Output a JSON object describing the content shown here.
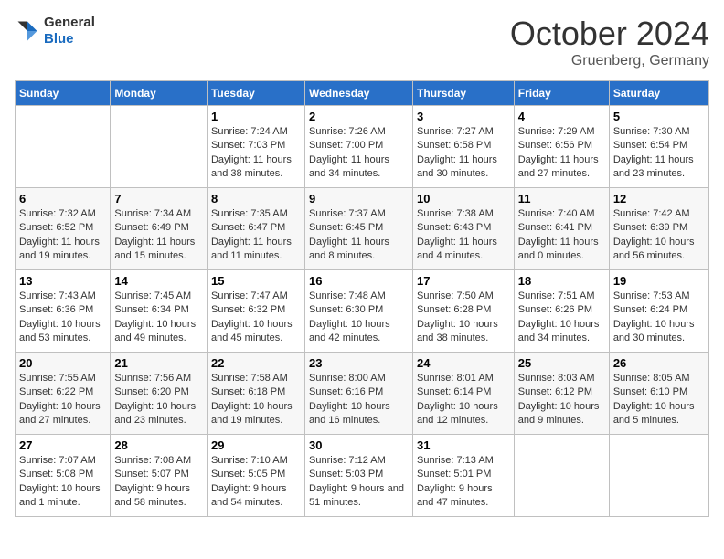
{
  "header": {
    "logo": {
      "general": "General",
      "blue": "Blue"
    },
    "title": "October 2024",
    "location": "Gruenberg, Germany"
  },
  "weekdays": [
    "Sunday",
    "Monday",
    "Tuesday",
    "Wednesday",
    "Thursday",
    "Friday",
    "Saturday"
  ],
  "weeks": [
    [
      {
        "day": "",
        "info": ""
      },
      {
        "day": "",
        "info": ""
      },
      {
        "day": "1",
        "info": "Sunrise: 7:24 AM\nSunset: 7:03 PM\nDaylight: 11 hours and 38 minutes."
      },
      {
        "day": "2",
        "info": "Sunrise: 7:26 AM\nSunset: 7:00 PM\nDaylight: 11 hours and 34 minutes."
      },
      {
        "day": "3",
        "info": "Sunrise: 7:27 AM\nSunset: 6:58 PM\nDaylight: 11 hours and 30 minutes."
      },
      {
        "day": "4",
        "info": "Sunrise: 7:29 AM\nSunset: 6:56 PM\nDaylight: 11 hours and 27 minutes."
      },
      {
        "day": "5",
        "info": "Sunrise: 7:30 AM\nSunset: 6:54 PM\nDaylight: 11 hours and 23 minutes."
      }
    ],
    [
      {
        "day": "6",
        "info": "Sunrise: 7:32 AM\nSunset: 6:52 PM\nDaylight: 11 hours and 19 minutes."
      },
      {
        "day": "7",
        "info": "Sunrise: 7:34 AM\nSunset: 6:49 PM\nDaylight: 11 hours and 15 minutes."
      },
      {
        "day": "8",
        "info": "Sunrise: 7:35 AM\nSunset: 6:47 PM\nDaylight: 11 hours and 11 minutes."
      },
      {
        "day": "9",
        "info": "Sunrise: 7:37 AM\nSunset: 6:45 PM\nDaylight: 11 hours and 8 minutes."
      },
      {
        "day": "10",
        "info": "Sunrise: 7:38 AM\nSunset: 6:43 PM\nDaylight: 11 hours and 4 minutes."
      },
      {
        "day": "11",
        "info": "Sunrise: 7:40 AM\nSunset: 6:41 PM\nDaylight: 11 hours and 0 minutes."
      },
      {
        "day": "12",
        "info": "Sunrise: 7:42 AM\nSunset: 6:39 PM\nDaylight: 10 hours and 56 minutes."
      }
    ],
    [
      {
        "day": "13",
        "info": "Sunrise: 7:43 AM\nSunset: 6:36 PM\nDaylight: 10 hours and 53 minutes."
      },
      {
        "day": "14",
        "info": "Sunrise: 7:45 AM\nSunset: 6:34 PM\nDaylight: 10 hours and 49 minutes."
      },
      {
        "day": "15",
        "info": "Sunrise: 7:47 AM\nSunset: 6:32 PM\nDaylight: 10 hours and 45 minutes."
      },
      {
        "day": "16",
        "info": "Sunrise: 7:48 AM\nSunset: 6:30 PM\nDaylight: 10 hours and 42 minutes."
      },
      {
        "day": "17",
        "info": "Sunrise: 7:50 AM\nSunset: 6:28 PM\nDaylight: 10 hours and 38 minutes."
      },
      {
        "day": "18",
        "info": "Sunrise: 7:51 AM\nSunset: 6:26 PM\nDaylight: 10 hours and 34 minutes."
      },
      {
        "day": "19",
        "info": "Sunrise: 7:53 AM\nSunset: 6:24 PM\nDaylight: 10 hours and 30 minutes."
      }
    ],
    [
      {
        "day": "20",
        "info": "Sunrise: 7:55 AM\nSunset: 6:22 PM\nDaylight: 10 hours and 27 minutes."
      },
      {
        "day": "21",
        "info": "Sunrise: 7:56 AM\nSunset: 6:20 PM\nDaylight: 10 hours and 23 minutes."
      },
      {
        "day": "22",
        "info": "Sunrise: 7:58 AM\nSunset: 6:18 PM\nDaylight: 10 hours and 19 minutes."
      },
      {
        "day": "23",
        "info": "Sunrise: 8:00 AM\nSunset: 6:16 PM\nDaylight: 10 hours and 16 minutes."
      },
      {
        "day": "24",
        "info": "Sunrise: 8:01 AM\nSunset: 6:14 PM\nDaylight: 10 hours and 12 minutes."
      },
      {
        "day": "25",
        "info": "Sunrise: 8:03 AM\nSunset: 6:12 PM\nDaylight: 10 hours and 9 minutes."
      },
      {
        "day": "26",
        "info": "Sunrise: 8:05 AM\nSunset: 6:10 PM\nDaylight: 10 hours and 5 minutes."
      }
    ],
    [
      {
        "day": "27",
        "info": "Sunrise: 7:07 AM\nSunset: 5:08 PM\nDaylight: 10 hours and 1 minute."
      },
      {
        "day": "28",
        "info": "Sunrise: 7:08 AM\nSunset: 5:07 PM\nDaylight: 9 hours and 58 minutes."
      },
      {
        "day": "29",
        "info": "Sunrise: 7:10 AM\nSunset: 5:05 PM\nDaylight: 9 hours and 54 minutes."
      },
      {
        "day": "30",
        "info": "Sunrise: 7:12 AM\nSunset: 5:03 PM\nDaylight: 9 hours and 51 minutes."
      },
      {
        "day": "31",
        "info": "Sunrise: 7:13 AM\nSunset: 5:01 PM\nDaylight: 9 hours and 47 minutes."
      },
      {
        "day": "",
        "info": ""
      },
      {
        "day": "",
        "info": ""
      }
    ]
  ]
}
